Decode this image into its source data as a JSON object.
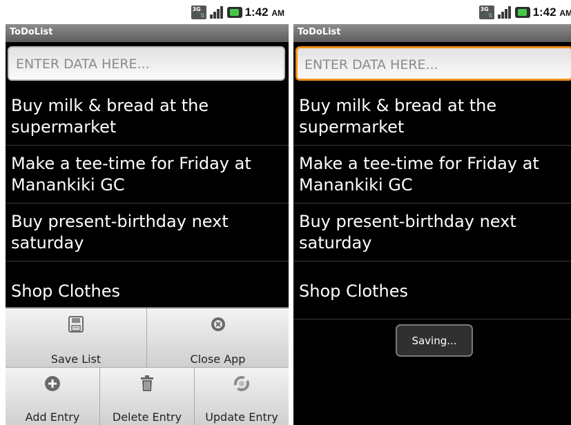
{
  "status_bar": {
    "network": "3G",
    "time": "1:42",
    "ampm": "AM"
  },
  "app": {
    "title": "ToDoList"
  },
  "input": {
    "placeholder": "ENTER DATA HERE..."
  },
  "todo_items": [
    "Buy milk & bread at the supermarket",
    "Make a tee-time for Friday at Manankiki GC",
    "Buy present-birthday next saturday",
    "Shop Clothes"
  ],
  "options_menu": {
    "save_list": "Save List",
    "close_app": "Close App",
    "add_entry": "Add Entry",
    "delete_entry": "Delete Entry",
    "update_entry": "Update Entry",
    "icons": [
      "save-icon",
      "close-circle-icon",
      "add-circle-icon",
      "trash-icon",
      "refresh-icon"
    ]
  },
  "toast": {
    "text": "Saving..."
  },
  "colors": {
    "focus_border": "#f2901c",
    "title_bar": "#6e6e6e",
    "list_bg": "#000000"
  }
}
